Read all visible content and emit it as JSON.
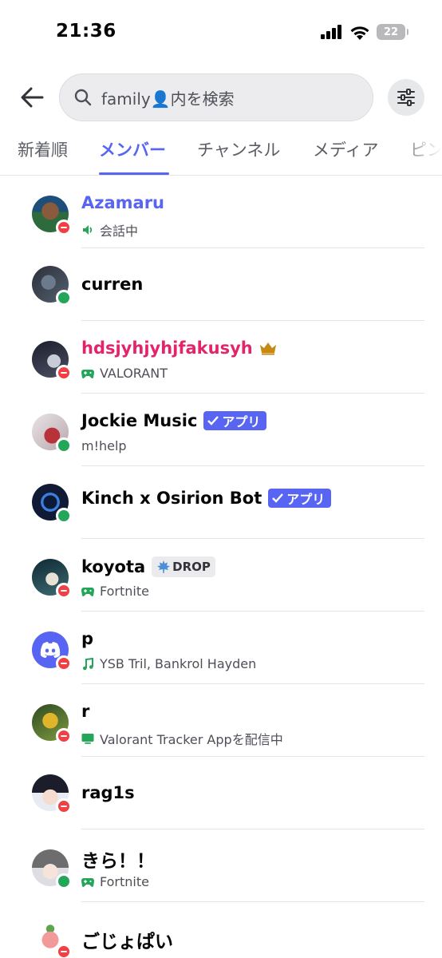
{
  "status_bar": {
    "time": "21:36",
    "battery": "22"
  },
  "search": {
    "query": "family👤内を検索"
  },
  "tabs": [
    {
      "label": "新着順",
      "active": false
    },
    {
      "label": "メンバー",
      "active": true
    },
    {
      "label": "チャンネル",
      "active": false
    },
    {
      "label": "メディア",
      "active": false
    },
    {
      "label": "ピン",
      "active": false
    }
  ],
  "members": [
    {
      "name": "Azamaru",
      "status": "dnd",
      "activity": "会話中",
      "activity_icon": "speaker-icon"
    },
    {
      "name": "curren",
      "status": "online"
    },
    {
      "name": "hdsjyhjyhjfakusyh",
      "status": "dnd",
      "activity": "VALORANT",
      "activity_icon": "gamepad-icon",
      "badge_icon": "crown-icon"
    },
    {
      "name": "Jockie Music",
      "status": "online",
      "activity": "m!help",
      "app_badge": "アプリ"
    },
    {
      "name": "Kinch x Osirion Bot",
      "status": "online",
      "app_badge": "アプリ"
    },
    {
      "name": "koyota",
      "status": "dnd",
      "activity": "Fortnite",
      "activity_icon": "gamepad-icon",
      "tag_badge": "DROP"
    },
    {
      "name": "p",
      "status": "dnd",
      "activity": "YSB Tril, Bankrol Hayden",
      "activity_icon": "music-note-icon"
    },
    {
      "name": "r",
      "status": "dnd",
      "activity": "Valorant Tracker Appを配信中",
      "activity_icon": "screen-icon"
    },
    {
      "name": "rag1s",
      "status": "dnd"
    },
    {
      "name": "きら！！",
      "status": "online",
      "activity": "Fortnite",
      "activity_icon": "gamepad-icon"
    },
    {
      "name": "ごじょぱい",
      "status": "dnd"
    }
  ],
  "colors": {
    "accent": "#5865f2",
    "online": "#23a55a",
    "dnd": "#f23f43",
    "role_pink": "#e3246b",
    "crown": "#c68a12"
  }
}
